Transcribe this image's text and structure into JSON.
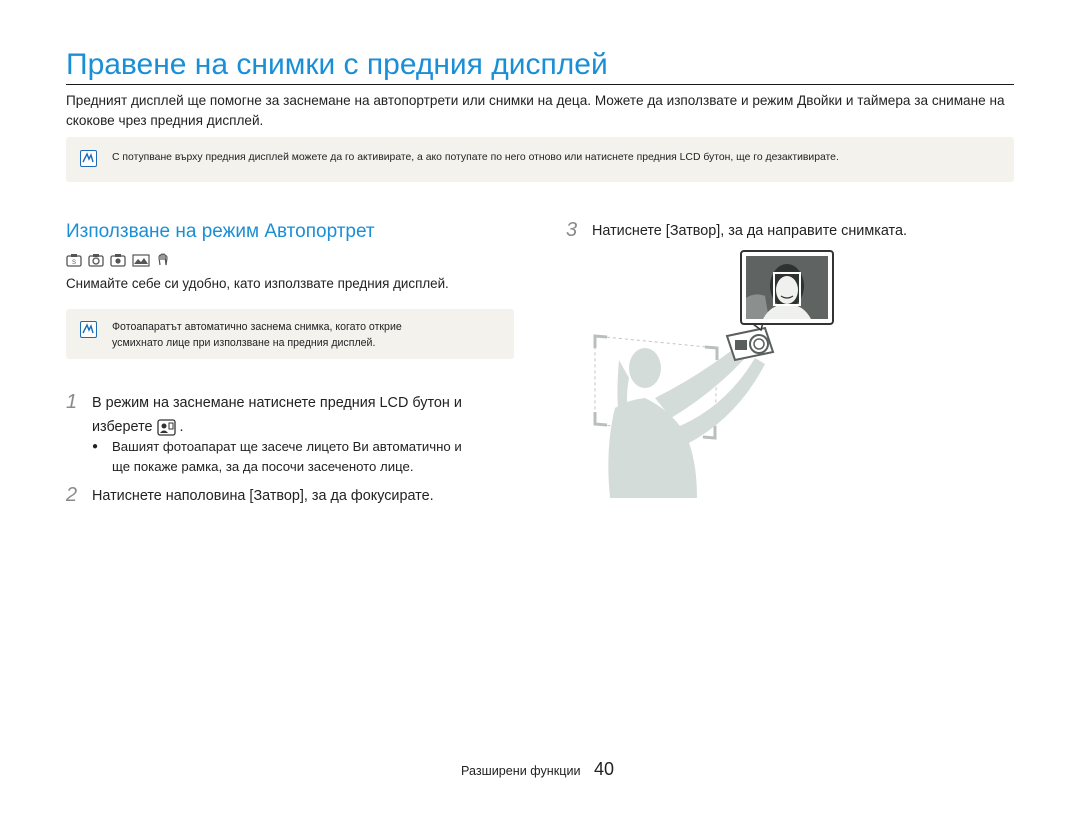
{
  "page": {
    "title": "Правене на снимки с предния дисплей",
    "intro": "Предният дисплей ще помогне за заснемане на автопортрети или снимки на деца. Можете да използвате и режим Двойки и таймера за снимане на скокове чрез предния дисплей.",
    "top_note": "С потупване върху предния дисплей можете да го активирате, а ако потупате по него отново или натиснете предния LCD бутон, ще го дезактивирате."
  },
  "section": {
    "heading": "Използване на режим Автопортрет",
    "mode_icons": [
      "smart-auto-icon",
      "camera-icon",
      "program-icon",
      "scene-icon",
      "dual-is-icon"
    ],
    "subtext": "Снимайте себе си удобно, като използвате предния дисплей.",
    "note": "Фотоапаратът автоматично заснема снимка, когато открие усмихнато лице при използване на предния дисплей.",
    "note_line1": "Фотоапаратът автоматично заснема снимка, когато открие",
    "note_line2": "усмихнато лице при използване на предния дисплей."
  },
  "steps": [
    {
      "num": "1",
      "line1": "В режим на заснемане натиснете предния LCD бутон и",
      "line2": "изберете",
      "line2_icon": "self-portrait-icon",
      "line2_end": ".",
      "bullet_line1": "Вашият фотоапарат ще засече лицето Ви автоматично и",
      "bullet_line2": "ще покаже рамка, за да посочи засеченото лице."
    },
    {
      "num": "2",
      "pre": "Натиснете наполовина [",
      "key": "Затвор",
      "post": "], за да фокусирате."
    },
    {
      "num": "3",
      "pre": "Натиснете [",
      "key": "Затвор",
      "post": "], за да направите снимката."
    }
  ],
  "footer": {
    "section_name": "Разширени функции",
    "page_number": "40"
  },
  "colors": {
    "title_blue": "#1a8fd6",
    "note_bg": "#f4f2ec",
    "note_icon_blue": "#1b6cb3",
    "illustration_gray": "#d4dcda"
  }
}
